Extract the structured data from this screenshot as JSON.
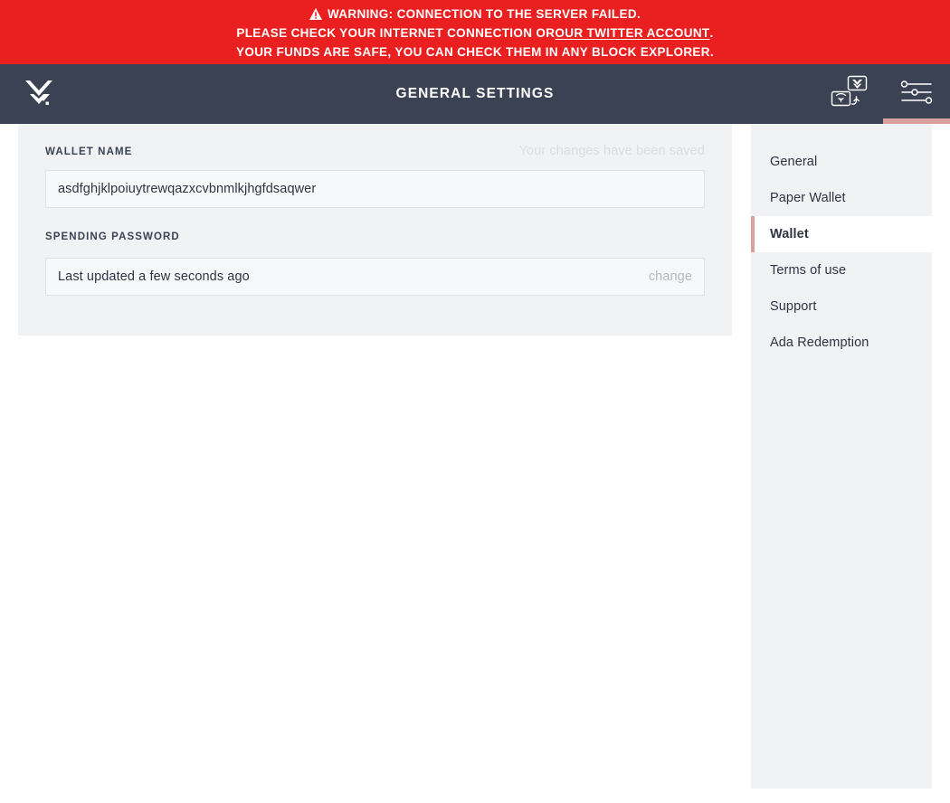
{
  "warning": {
    "icon": "warning-triangle-icon",
    "line1": "Warning: Connection to the server failed.",
    "line2_before": "Please check your internet connection or ",
    "line2_link": "our Twitter account",
    "line2_after": ".",
    "line3": "Your funds are safe, you can check them in any block explorer.",
    "background_color": "#ea1f1f",
    "text_color": "#ffffff"
  },
  "top_bar": {
    "logo_icon": "daedalus-logo-icon",
    "title": "General Settings",
    "background_color": "#3b4253",
    "actions": [
      {
        "icon": "wallet-switch-icon",
        "name": "wallet-switch-button",
        "active": false
      },
      {
        "icon": "settings-sliders-icon",
        "name": "settings-button",
        "active": true
      }
    ],
    "active_indicator_color": "#d9a0a0"
  },
  "settings_pane": {
    "wallet_name": {
      "label": "Wallet name",
      "value": "asdfghjklpoiuytrewqazxcvbnmlkjhgfdsaqwer",
      "placeholder": "Wallet name"
    },
    "save_status": "Your changes have been saved",
    "spending_password": {
      "label": "Spending password",
      "status": "Last updated a few seconds ago",
      "change_label": "change"
    },
    "background_color": "#f1f2f4"
  },
  "settings_menu": {
    "items": [
      {
        "label": "General",
        "active": false
      },
      {
        "label": "Paper Wallet",
        "active": false
      },
      {
        "label": "Wallet",
        "active": true
      },
      {
        "label": "Terms of use",
        "active": false
      },
      {
        "label": "Support",
        "active": false
      },
      {
        "label": "Ada Redemption",
        "active": false
      }
    ],
    "active_accent_color": "#d9a0a0",
    "background_color": "#f1f2f4"
  }
}
